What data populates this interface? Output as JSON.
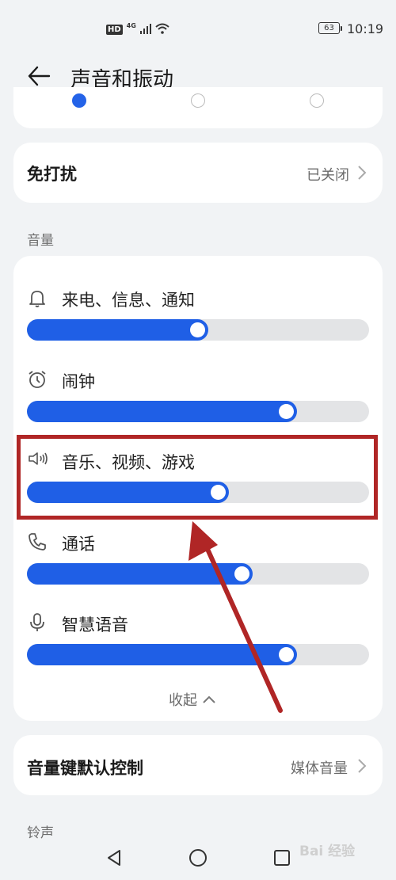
{
  "status_bar": {
    "hd": "HD",
    "network": "4G",
    "battery": "63",
    "time": "10:19"
  },
  "header": {
    "title": "声音和振动"
  },
  "dnd": {
    "label": "免打扰",
    "value": "已关闭"
  },
  "volume_section": {
    "title": "音量",
    "items": [
      {
        "label": "来电、信息、通知",
        "icon": "bell-icon",
        "level": 0.53
      },
      {
        "label": "闹钟",
        "icon": "alarm-clock-icon",
        "level": 0.79
      },
      {
        "label": "音乐、视频、游戏",
        "icon": "speaker-icon",
        "level": 0.59
      },
      {
        "label": "通话",
        "icon": "phone-icon",
        "level": 0.66
      },
      {
        "label": "智慧语音",
        "icon": "microphone-icon",
        "level": 0.79
      }
    ],
    "collapse_label": "收起"
  },
  "volume_key": {
    "label": "音量键默认控制",
    "value": "媒体音量"
  },
  "ringtone_section": {
    "title": "铃声"
  },
  "colors": {
    "accent": "#1f5fe6",
    "highlight": "#b02626"
  },
  "watermark": "Bai 经验"
}
